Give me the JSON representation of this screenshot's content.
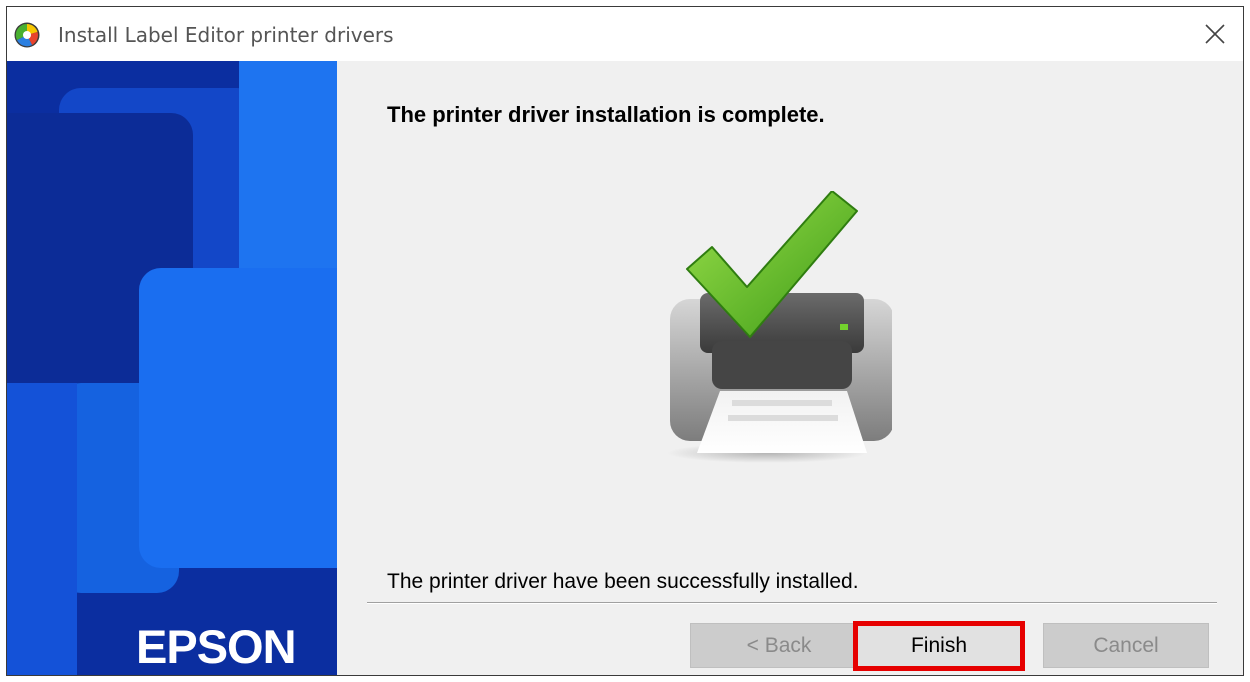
{
  "window": {
    "title": "Install Label Editor printer drivers",
    "close_glyph": "✕"
  },
  "sidebar": {
    "brand": "EPSON"
  },
  "content": {
    "heading": "The printer driver installation is complete.",
    "illustration_icon": "printer-with-checkmark-icon",
    "message": "The printer driver have been successfully installed."
  },
  "buttons": {
    "back_label": "< Back",
    "finish_label": "Finish",
    "cancel_label": "Cancel"
  },
  "colors": {
    "sidebar_dark_blue": "#0b2ea0",
    "sidebar_light_blue": "#1e74f0",
    "highlight_red": "#e60000",
    "check_green": "#5fb21f"
  }
}
